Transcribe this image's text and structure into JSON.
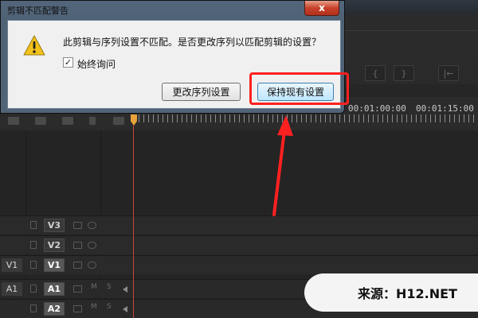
{
  "dialog": {
    "title": "剪辑不匹配警告",
    "close_glyph": "x",
    "icon": "warning-icon",
    "message": "此剪辑与序列设置不匹配。是否更改序列以匹配剪辑的设置？",
    "checkbox": {
      "label": "始终询问",
      "checked": true,
      "glyph": "✓"
    },
    "buttons": {
      "change": "更改序列设置",
      "keep": "保持现有设置"
    }
  },
  "timeline": {
    "timecodes": [
      "00:01:00:00",
      "00:01:15:00"
    ],
    "tracks": [
      {
        "label": "V3",
        "source": ""
      },
      {
        "label": "V2",
        "source": ""
      },
      {
        "label": "V1",
        "source": "V1"
      },
      {
        "label": "A1",
        "source": "A1"
      },
      {
        "label": "A2",
        "source": ""
      }
    ],
    "audio_controls": {
      "mute": "M",
      "solo": "S"
    }
  },
  "transport": {
    "buttons": [
      "{",
      "}",
      "|←"
    ]
  },
  "watermark": {
    "text": "来源：H12.NET"
  },
  "colors": {
    "annotation": "#ff2020",
    "playhead": "#e8a33a",
    "dialog_frame": "#5a7087"
  }
}
